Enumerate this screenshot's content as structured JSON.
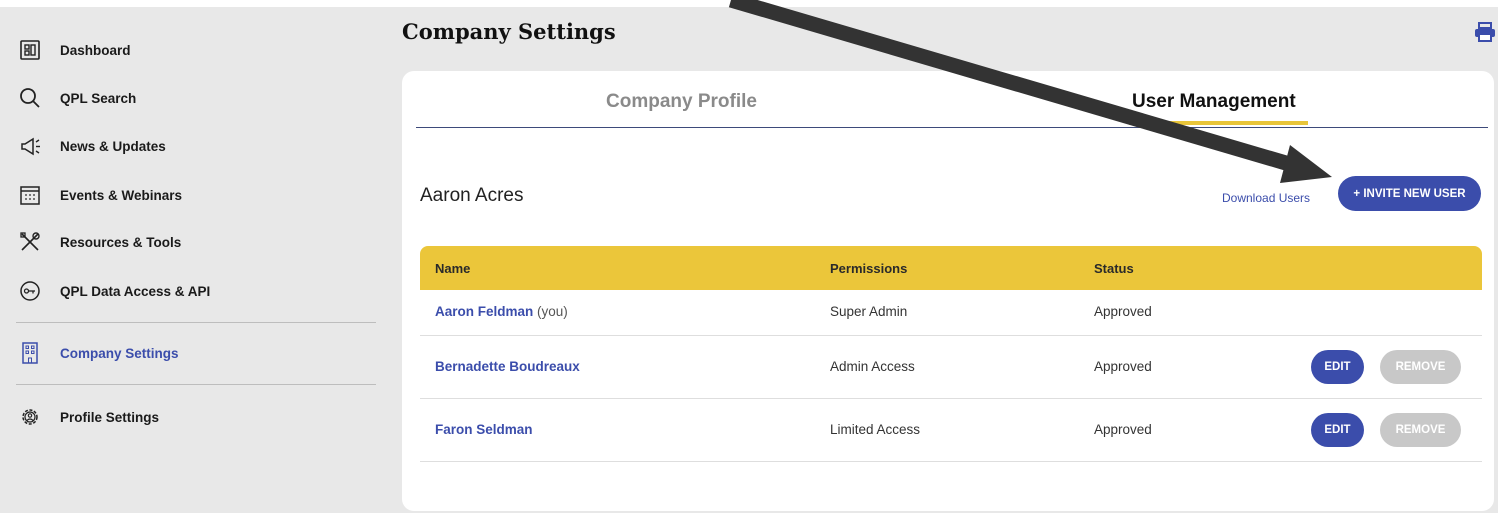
{
  "sidebar": {
    "items": [
      {
        "label": "Dashboard",
        "icon": "dashboard-icon"
      },
      {
        "label": "QPL Search",
        "icon": "search-icon"
      },
      {
        "label": "News & Updates",
        "icon": "megaphone-icon"
      },
      {
        "label": "Events & Webinars",
        "icon": "calendar-icon"
      },
      {
        "label": "Resources & Tools",
        "icon": "tools-icon"
      },
      {
        "label": "QPL Data Access & API",
        "icon": "key-icon"
      },
      {
        "label": "Company Settings",
        "icon": "building-icon",
        "active": true
      },
      {
        "label": "Profile Settings",
        "icon": "gear-user-icon"
      }
    ]
  },
  "page": {
    "title": "Company Settings"
  },
  "tabs": {
    "profile": "Company Profile",
    "users": "User Management"
  },
  "users_panel": {
    "company_name": "Aaron Acres",
    "download_label": "Download Users",
    "invite_label": "+ INVITE NEW USER"
  },
  "table": {
    "headers": [
      "Name",
      "Permissions",
      "Status"
    ],
    "rows": [
      {
        "name": "Aaron Feldman",
        "suffix": " (you)",
        "permission": "Super Admin",
        "status": "Approved"
      },
      {
        "name": "Bernadette Boudreaux",
        "permission": "Admin Access",
        "status": "Approved",
        "edit": "EDIT",
        "remove": "REMOVE"
      },
      {
        "name": "Faron Seldman",
        "permission": "Limited Access",
        "status": "Approved",
        "edit": "EDIT",
        "remove": "REMOVE"
      }
    ]
  },
  "colors": {
    "accent": "#3b4dab",
    "header_yellow": "#ebc63a",
    "sidebar_bg": "#e8e8e8",
    "remove_gray": "#c8c8c8"
  }
}
